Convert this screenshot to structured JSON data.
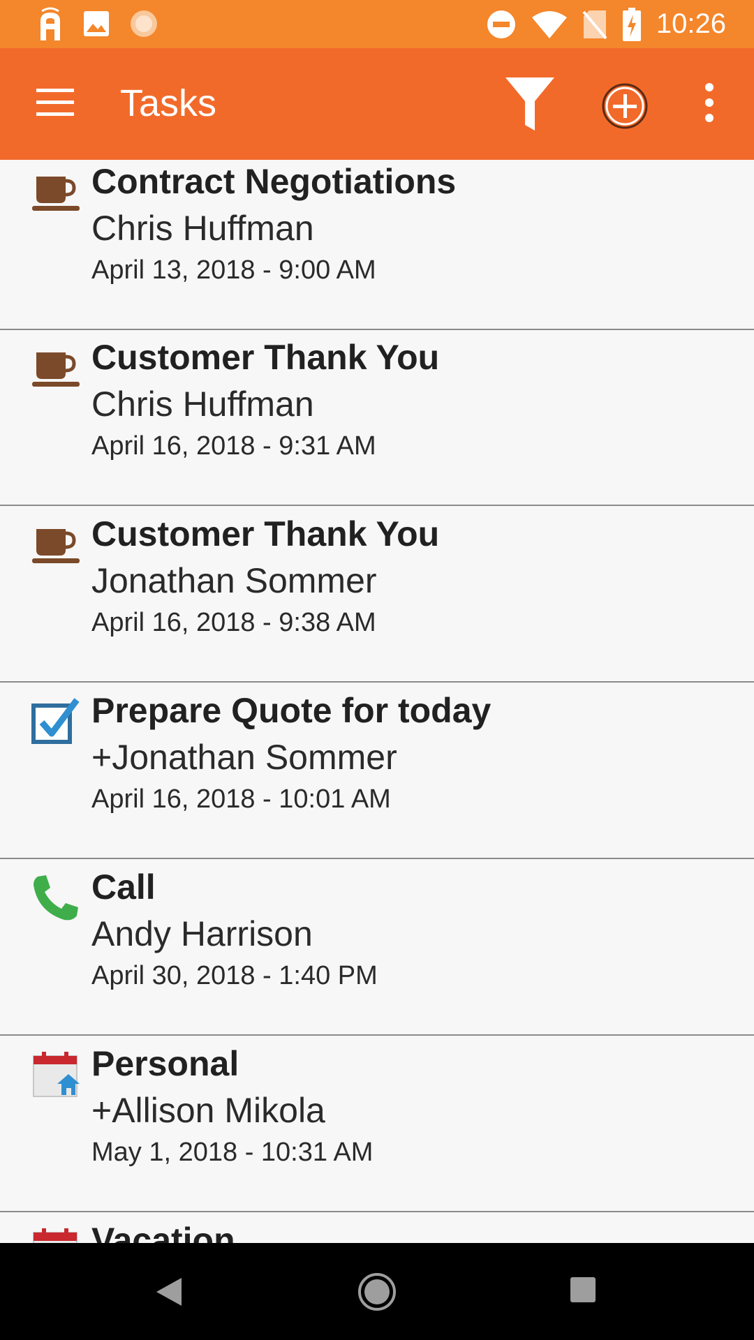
{
  "status_bar": {
    "time": "10:26",
    "icons": [
      "app-notification-icon",
      "image-icon",
      "sync-icon",
      "do-not-disturb-icon",
      "wifi-icon",
      "no-sim-icon",
      "battery-charging-icon"
    ]
  },
  "app_bar": {
    "title": "Tasks",
    "actions": [
      "menu-icon",
      "filter-icon",
      "add-circle-icon",
      "more-vertical-icon"
    ]
  },
  "colors": {
    "status_bar": "#f4862b",
    "app_bar": "#f26a2a",
    "list_background": "#f7f7f7",
    "divider": "#8a8a8a"
  },
  "tasks": [
    {
      "icon": "coffee-cup-icon",
      "title": "Contract Negotiations",
      "contact": "Chris Huffman",
      "date": "April 13, 2018 - 9:00 AM"
    },
    {
      "icon": "coffee-cup-icon",
      "title": "Customer Thank You",
      "contact": "Chris Huffman",
      "date": "April 16, 2018 - 9:31 AM"
    },
    {
      "icon": "coffee-cup-icon",
      "title": "Customer Thank You",
      "contact": "Jonathan Sommer",
      "date": "April 16, 2018 - 9:38 AM"
    },
    {
      "icon": "checkbox-checked-icon",
      "title": "Prepare Quote for today",
      "contact": "+Jonathan Sommer",
      "date": "April 16, 2018 - 10:01 AM"
    },
    {
      "icon": "phone-icon",
      "title": "Call",
      "contact": "Andy Harrison",
      "date": "April 30, 2018 - 1:40 PM"
    },
    {
      "icon": "calendar-home-icon",
      "title": "Personal",
      "contact": "+Allison Mikola",
      "date": "May 1, 2018 - 10:31 AM"
    },
    {
      "icon": "calendar-icon",
      "title": "Vacation",
      "contact": "",
      "date": ""
    }
  ],
  "nav_bar": {
    "buttons": [
      "back-icon",
      "home-icon",
      "recents-icon"
    ]
  }
}
